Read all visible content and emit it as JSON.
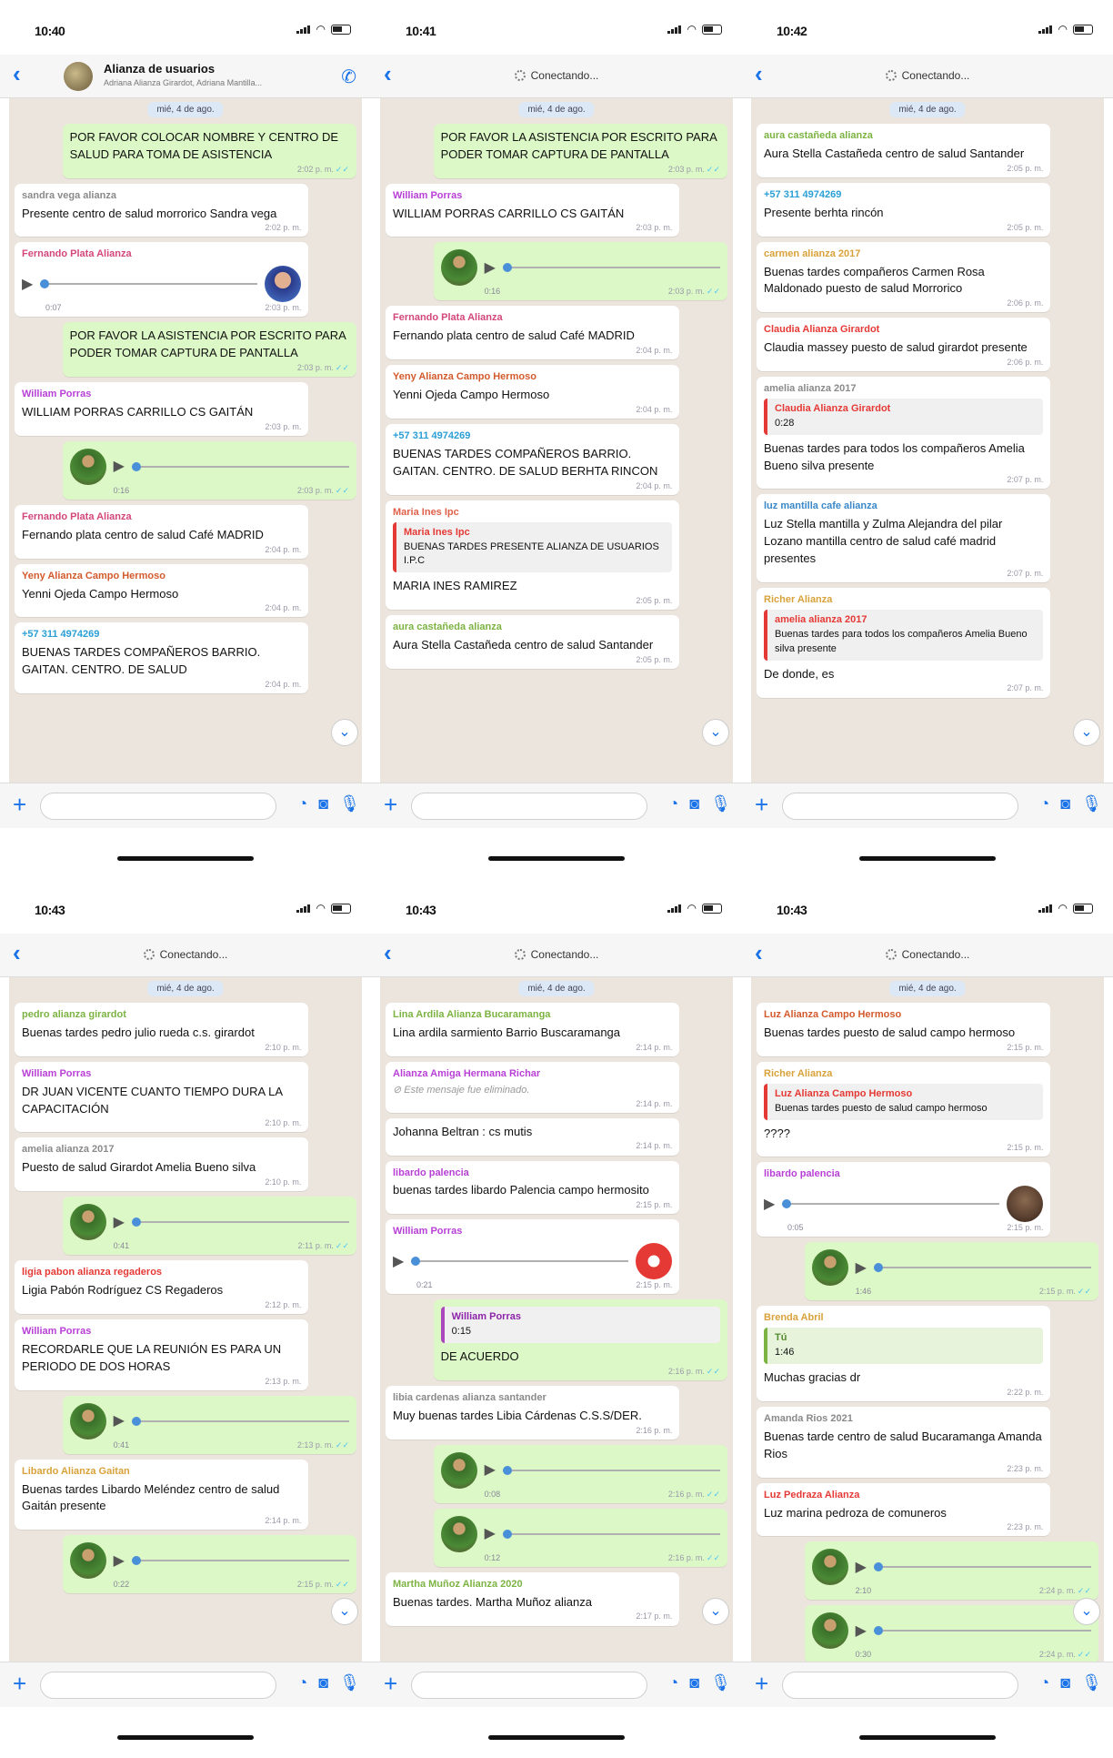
{
  "phones": [
    {
      "time": "10:40",
      "header": {
        "mode": "group",
        "title": "Alianza de usuarios",
        "subtitle": "Adriana Alianza Girardot, Adriana Mantilla..."
      },
      "date": "mié, 4 de ago.",
      "messages": [
        {
          "type": "text",
          "dir": "out",
          "text": "POR FAVOR COLOCAR NOMBRE Y CENTRO DE SALUD PARA TOMA DE ASISTENCIA",
          "time": "2:02 p. m."
        },
        {
          "type": "text",
          "dir": "in",
          "sender": "sandra vega alianza",
          "sender_color": "#8a8a8a",
          "text": "Presente centro de salud morrorico Sandra vega",
          "time": "2:02 p. m."
        },
        {
          "type": "audio",
          "dir": "in",
          "sender": "Fernando Plata Alianza",
          "sender_color": "#d3477a",
          "avatar": "face",
          "duration": "0:07",
          "time": "2:03 p. m."
        },
        {
          "type": "text",
          "dir": "out",
          "text": "POR FAVOR LA ASISTENCIA POR ESCRITO PARA PODER TOMAR CAPTURA DE PANTALLA",
          "time": "2:03 p. m."
        },
        {
          "type": "text",
          "dir": "in",
          "sender": "William Porras",
          "sender_color": "#b83fd6",
          "text": "WILLIAM PORRAS CARRILLO CS GAITÁN",
          "time": "2:03 p. m."
        },
        {
          "type": "audio",
          "dir": "out",
          "avatar": "group",
          "duration": "0:16",
          "time": "2:03 p. m."
        },
        {
          "type": "text",
          "dir": "in",
          "sender": "Fernando Plata Alianza",
          "sender_color": "#d3477a",
          "text": "Fernando plata centro de salud Café MADRID",
          "time": "2:04 p. m."
        },
        {
          "type": "text",
          "dir": "in",
          "sender": "Yeny Alianza Campo Hermoso",
          "sender_color": "#d35a2c",
          "text": "Yenni Ojeda Campo Hermoso",
          "time": "2:04 p. m."
        },
        {
          "type": "text",
          "dir": "in",
          "sender": "+57 311 4974269",
          "sender_color": "#2a9fd6",
          "text": "BUENAS TARDES COMPAÑEROS BARRIO. GAITAN. CENTRO. DE SALUD",
          "time": "2:04 p. m."
        }
      ]
    },
    {
      "time": "10:41",
      "header": {
        "mode": "connecting",
        "title": "Conectando..."
      },
      "date": "mié, 4 de ago.",
      "messages": [
        {
          "type": "text",
          "dir": "out",
          "text": "POR FAVOR LA ASISTENCIA POR ESCRITO PARA PODER TOMAR CAPTURA DE PANTALLA",
          "time": "2:03 p. m."
        },
        {
          "type": "text",
          "dir": "in",
          "sender": "William Porras",
          "sender_color": "#b83fd6",
          "text": "WILLIAM PORRAS CARRILLO CS GAITÁN",
          "time": "2:03 p. m."
        },
        {
          "type": "audio",
          "dir": "out",
          "avatar": "group",
          "duration": "0:16",
          "time": "2:03 p. m."
        },
        {
          "type": "text",
          "dir": "in",
          "sender": "Fernando Plata Alianza",
          "sender_color": "#d3477a",
          "text": "Fernando plata centro de salud Café MADRID",
          "time": "2:04 p. m."
        },
        {
          "type": "text",
          "dir": "in",
          "sender": "Yeny Alianza Campo Hermoso",
          "sender_color": "#d35a2c",
          "text": "Yenni Ojeda Campo Hermoso",
          "time": "2:04 p. m."
        },
        {
          "type": "text",
          "dir": "in",
          "sender": "+57 311 4974269",
          "sender_color": "#2a9fd6",
          "text": "BUENAS TARDES COMPAÑEROS BARRIO. GAITAN. CENTRO. DE SALUD BERHTA RINCON",
          "time": "2:04 p. m."
        },
        {
          "type": "quote",
          "dir": "in",
          "sender": "Maria Ines Ipc",
          "sender_color": "#e0604a",
          "quote_sender": "Maria Ines Ipc",
          "quote_text": "BUENAS TARDES PRESENTE ALIANZA DE USUARIOS I.P.C",
          "text": "MARIA INES RAMIREZ",
          "time": "2:05 p. m."
        },
        {
          "type": "text",
          "dir": "in",
          "sender": "aura castañeda alianza",
          "sender_color": "#7cb342",
          "text": "Aura Stella Castañeda centro de salud Santander",
          "time": "2:05 p. m."
        }
      ]
    },
    {
      "time": "10:42",
      "header": {
        "mode": "connecting",
        "title": "Conectando..."
      },
      "date": "mié, 4 de ago.",
      "messages": [
        {
          "type": "text",
          "dir": "in",
          "sender": "aura castañeda alianza",
          "sender_color": "#7cb342",
          "text": "Aura Stella Castañeda centro de salud Santander",
          "time": "2:05 p. m."
        },
        {
          "type": "text",
          "dir": "in",
          "sender": "+57 311 4974269",
          "sender_color": "#2a9fd6",
          "text": "Presente berhta rincón",
          "time": "2:05 p. m."
        },
        {
          "type": "text",
          "dir": "in",
          "sender": "carmen alianza 2017",
          "sender_color": "#d9a23a",
          "text": "Buenas tardes compañeros Carmen Rosa Maldonado puesto de salud Morrorico",
          "time": "2:06 p. m."
        },
        {
          "type": "text",
          "dir": "in",
          "sender": "Claudia Alianza Girardot",
          "sender_color": "#e53935",
          "text": "Claudia massey puesto de salud girardot presente",
          "time": "2:06 p. m."
        },
        {
          "type": "quote",
          "dir": "in",
          "sender": "amelia alianza 2017",
          "sender_color": "#8a8a8a",
          "quote_sender": "Claudia Alianza Girardot",
          "quote_text": "0:28",
          "text": "Buenas tardes para todos los compañeros Amelia Bueno silva presente",
          "time": "2:07 p. m."
        },
        {
          "type": "text",
          "dir": "in",
          "sender": "luz mantilla cafe alianza",
          "sender_color": "#3a87c9",
          "text": "Luz Stella mantilla y Zulma Alejandra del pilar Lozano mantilla centro de salud café madrid presentes",
          "time": "2:07 p. m."
        },
        {
          "type": "quote",
          "dir": "in",
          "sender": "Richer Alianza",
          "sender_color": "#d9a23a",
          "quote_sender": "amelia alianza 2017",
          "quote_text": "Buenas tardes para todos los compañeros Amelia Bueno silva presente",
          "text": "De donde, es",
          "time": "2:07 p. m."
        }
      ]
    },
    {
      "time": "10:43",
      "header": {
        "mode": "connecting",
        "title": "Conectando..."
      },
      "date": "mié, 4 de ago.",
      "messages": [
        {
          "type": "text",
          "dir": "in",
          "sender": "pedro alianza girardot",
          "sender_color": "#7cb342",
          "text": "Buenas tardes pedro julio rueda c.s. girardot",
          "time": "2:10 p. m."
        },
        {
          "type": "text",
          "dir": "in",
          "sender": "William Porras",
          "sender_color": "#b83fd6",
          "text": "DR JUAN VICENTE CUANTO TIEMPO DURA LA CAPACITACIÓN",
          "time": "2:10 p. m."
        },
        {
          "type": "text",
          "dir": "in",
          "sender": "amelia alianza 2017",
          "sender_color": "#8a8a8a",
          "text": "Puesto de salud Girardot Amelia Bueno silva",
          "time": "2:10 p. m."
        },
        {
          "type": "audio",
          "dir": "out",
          "avatar": "group",
          "duration": "0:41",
          "time": "2:11 p. m."
        },
        {
          "type": "text",
          "dir": "in",
          "sender": "ligia pabon alianza regaderos",
          "sender_color": "#e53935",
          "text": "Ligia Pabón Rodríguez CS Regaderos",
          "time": "2:12 p. m."
        },
        {
          "type": "text",
          "dir": "in",
          "sender": "William Porras",
          "sender_color": "#b83fd6",
          "text": "RECORDARLE QUE LA REUNIÓN ES PARA UN PERIODO DE DOS HORAS",
          "time": "2:13 p. m."
        },
        {
          "type": "audio",
          "dir": "out",
          "avatar": "group",
          "duration": "0:41",
          "time": "2:13 p. m."
        },
        {
          "type": "text",
          "dir": "in",
          "sender": "Libardo Alianza Gaitan",
          "sender_color": "#d9a23a",
          "text": "Buenas tardes Libardo Meléndez centro de salud Gaitán presente",
          "time": "2:14 p. m."
        },
        {
          "type": "audio",
          "dir": "out",
          "avatar": "group",
          "duration": "0:22",
          "time": "2:15 p. m."
        }
      ]
    },
    {
      "time": "10:43",
      "header": {
        "mode": "connecting",
        "title": "Conectando..."
      },
      "date": "mié, 4 de ago.",
      "messages": [
        {
          "type": "text",
          "dir": "in",
          "sender": "Lina Ardila Alianza Bucaramanga",
          "sender_color": "#7cb342",
          "text": "Lina ardila sarmiento Barrio Buscaramanga",
          "time": "2:14 p. m."
        },
        {
          "type": "text",
          "dir": "in",
          "sender": "Alianza Amiga Hermana Richar",
          "sender_color": "#b83fd6",
          "text": "⊘ Este mensaje fue eliminado.",
          "time": "2:14 p. m."
        },
        {
          "type": "text",
          "dir": "in",
          "text": "Johanna Beltran : cs mutis",
          "time": "2:14 p. m."
        },
        {
          "type": "text",
          "dir": "in",
          "sender": "libardo palencia",
          "sender_color": "#b83fd6",
          "text": "buenas tardes libardo Palencia campo hermosito",
          "time": "2:15 p. m."
        },
        {
          "type": "audio",
          "dir": "in",
          "sender": "William Porras",
          "sender_color": "#b83fd6",
          "avatar": "red",
          "duration": "0:21",
          "time": "2:15 p. m."
        },
        {
          "type": "quote",
          "dir": "out",
          "quote_sender": "William Porras",
          "quote_text": "0:15",
          "quote_style": "purple",
          "text": "DE ACUERDO",
          "time": "2:16 p. m."
        },
        {
          "type": "text",
          "dir": "in",
          "sender": "libia cardenas alianza santander",
          "sender_color": "#8a8a8a",
          "text": "Muy buenas tardes Libia Cárdenas C.S.S/DER.",
          "time": "2:16 p. m."
        },
        {
          "type": "audio",
          "dir": "out",
          "avatar": "group",
          "duration": "0:08",
          "time": "2:16 p. m."
        },
        {
          "type": "audio",
          "dir": "out",
          "avatar": "group",
          "duration": "0:12",
          "time": "2:16 p. m."
        },
        {
          "type": "text",
          "dir": "in",
          "sender": "Martha Muñoz Alianza 2020",
          "sender_color": "#7cb342",
          "text": "Buenas tardes. Martha Muñoz alianza",
          "time": "2:17 p. m."
        }
      ]
    },
    {
      "time": "10:43",
      "header": {
        "mode": "connecting",
        "title": "Conectando..."
      },
      "date": "mié, 4 de ago.",
      "messages": [
        {
          "type": "text",
          "dir": "in",
          "sender": "Luz Alianza Campo Hermoso",
          "sender_color": "#d35a2c",
          "text": "Buenas tardes puesto de salud campo hermoso",
          "time": "2:15 p. m."
        },
        {
          "type": "quote",
          "dir": "in",
          "sender": "Richer Alianza",
          "sender_color": "#d9a23a",
          "quote_sender": "Luz Alianza Campo Hermoso",
          "quote_text": "Buenas tardes puesto de salud campo hermoso",
          "text": "????",
          "time": "2:15 p. m."
        },
        {
          "type": "audio",
          "dir": "in",
          "sender": "libardo palencia",
          "sender_color": "#b83fd6",
          "avatar": "dark",
          "duration": "0:05",
          "time": "2:15 p. m."
        },
        {
          "type": "audio",
          "dir": "out",
          "avatar": "group",
          "duration": "1:46",
          "time": "2:15 p. m."
        },
        {
          "type": "quote",
          "dir": "in",
          "sender": "Brenda Abril",
          "sender_color": "#d9a23a",
          "quote_sender": "Tú",
          "quote_text": "1:46",
          "quote_style": "green",
          "text": "Muchas gracias dr",
          "time": "2:22 p. m."
        },
        {
          "type": "text",
          "dir": "in",
          "sender": "Amanda Rios 2021",
          "sender_color": "#8a8a8a",
          "text": "Buenas tarde centro de salud Bucaramanga Amanda Rios",
          "time": "2:23 p. m."
        },
        {
          "type": "text",
          "dir": "in",
          "sender": "Luz Pedraza Alianza",
          "sender_color": "#e53935",
          "text": "Luz marina pedroza de comuneros",
          "time": "2:23 p. m."
        },
        {
          "type": "audio",
          "dir": "out",
          "avatar": "group",
          "duration": "2:10",
          "time": "2:24 p. m."
        },
        {
          "type": "audio",
          "dir": "out",
          "avatar": "group",
          "duration": "0:30",
          "time": "2:24 p. m."
        }
      ]
    }
  ]
}
